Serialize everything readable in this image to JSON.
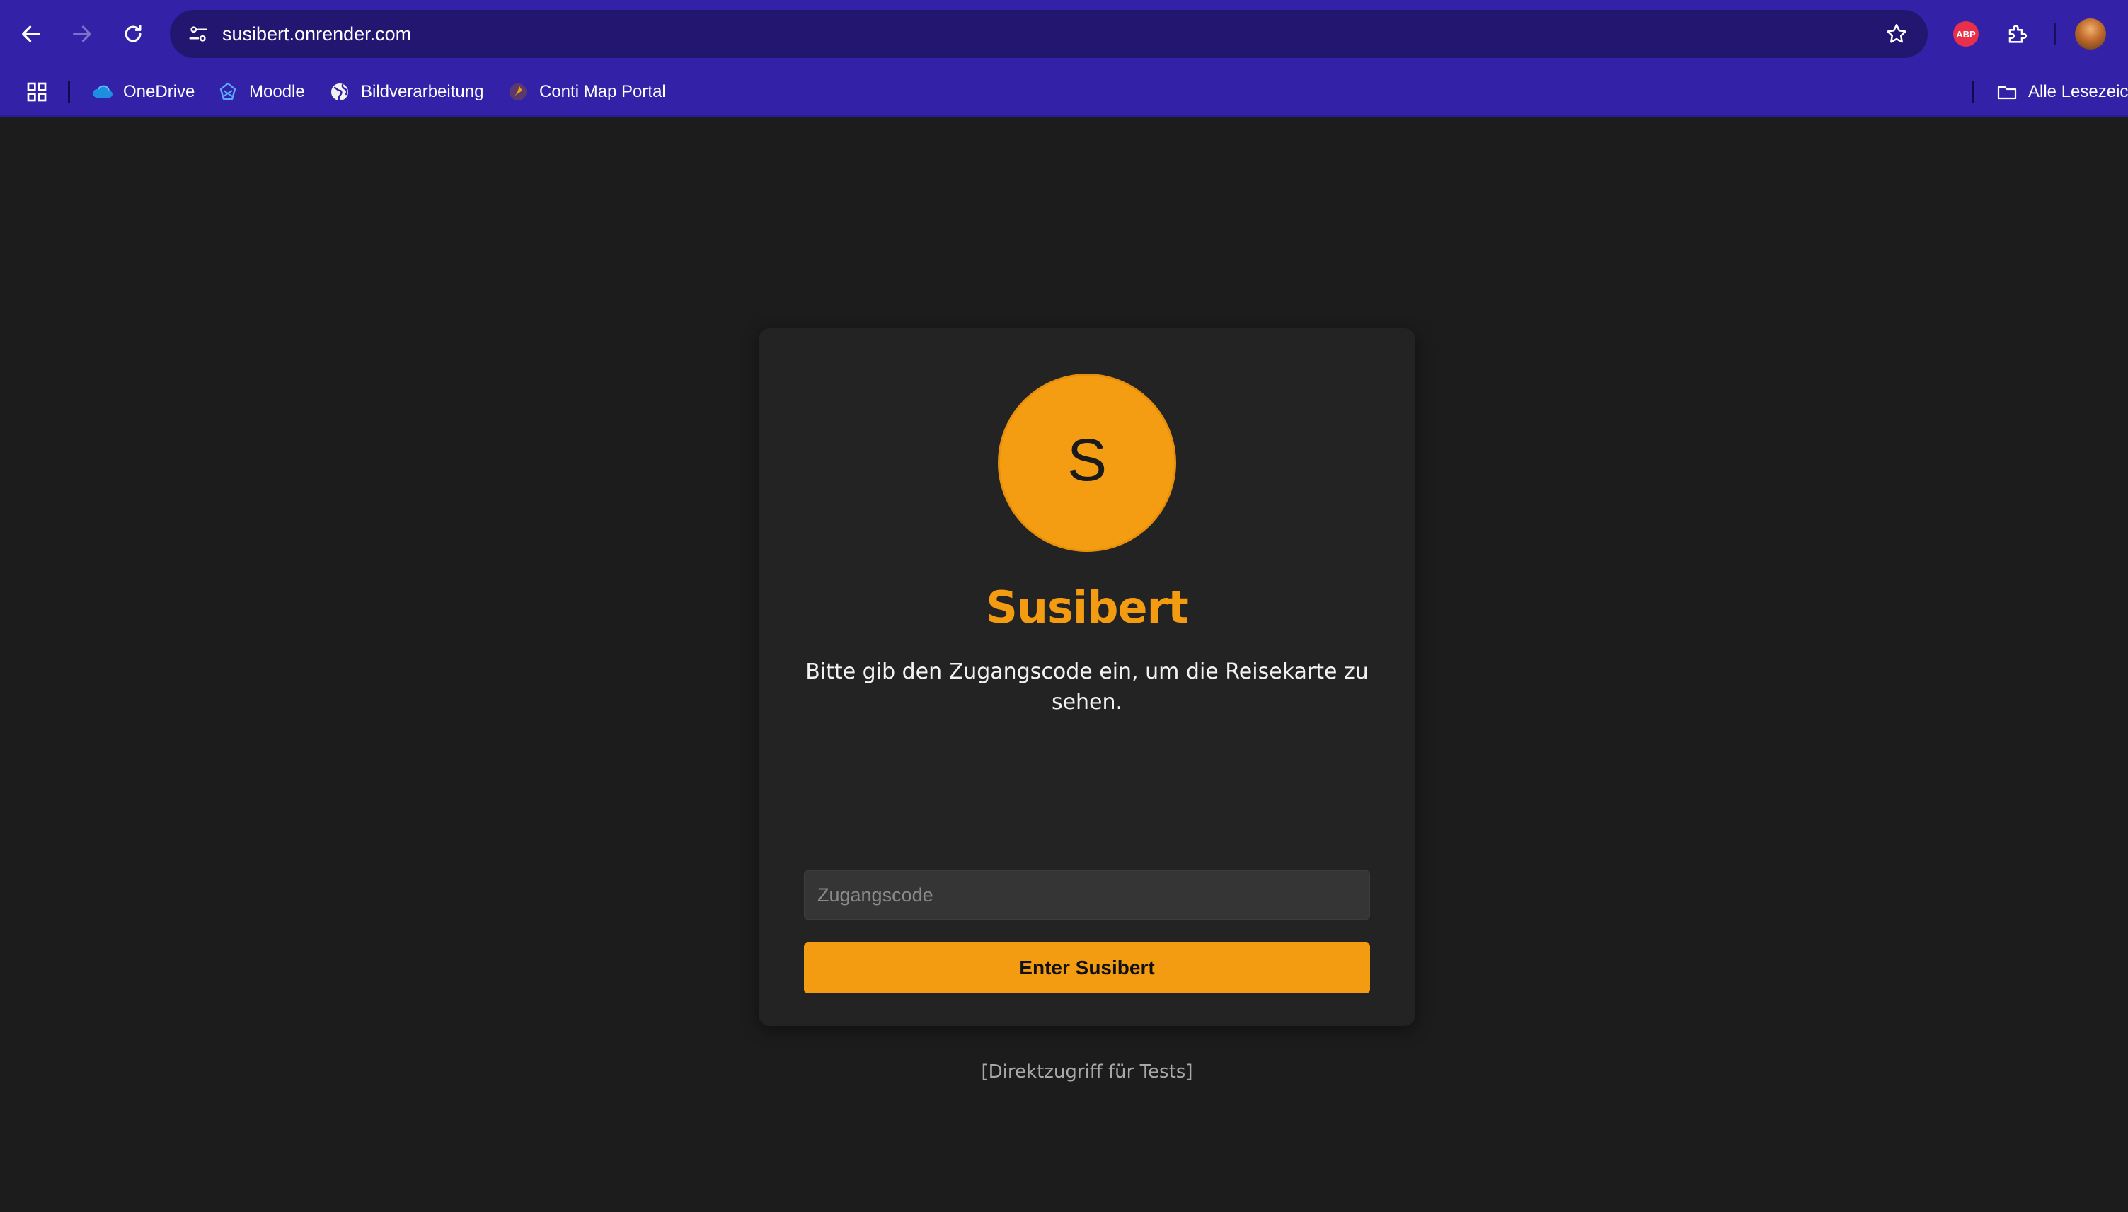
{
  "browser": {
    "url": "susibert.onrender.com",
    "extensions": {
      "abp_label": "ABP"
    },
    "bookmarks": [
      {
        "label": "OneDrive",
        "icon": "onedrive-icon"
      },
      {
        "label": "Moodle",
        "icon": "moodle-icon"
      },
      {
        "label": "Bildverarbeitung",
        "icon": "globe-icon"
      },
      {
        "label": "Conti Map Portal",
        "icon": "conti-icon"
      }
    ],
    "all_bookmarks_label": "Alle Lesezeic"
  },
  "login": {
    "logo_letter": "S",
    "title": "Susibert",
    "instruction": "Bitte gib den Zugangscode ein, um die Reisekarte zu sehen.",
    "input_placeholder": "Zugangscode",
    "input_value": "",
    "submit_label": "Enter Susibert",
    "direct_access_link": "[Direktzugriff für Tests]"
  },
  "colors": {
    "chrome_bg": "#3321a8",
    "page_bg": "#1c1c1c",
    "card_bg": "#232323",
    "accent": "#f39c12"
  }
}
